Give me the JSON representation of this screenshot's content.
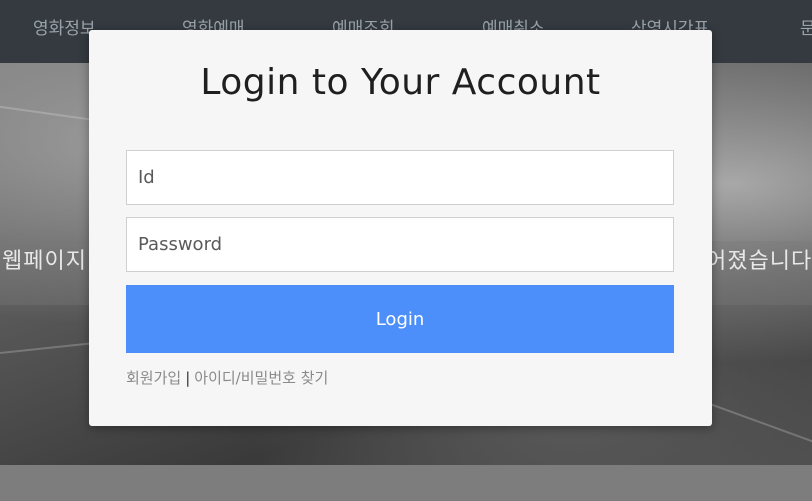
{
  "nav": {
    "items": [
      "영화정보",
      "영화예매",
      "예매조회",
      "예매취소",
      "상영시간표",
      "문"
    ]
  },
  "hero": {
    "left_text": "웹페이지",
    "right_text": "어졌습니다"
  },
  "login": {
    "title": "Login to Your Account",
    "id_placeholder": "Id",
    "password_placeholder": "Password",
    "button_label": "Login",
    "signup_label": "회원가입",
    "separator": "|",
    "find_label": "아이디/비밀번호 찾기"
  },
  "colors": {
    "nav_bg": "#343a40",
    "button_bg": "#4c8ffb",
    "modal_bg": "#f6f6f6"
  }
}
